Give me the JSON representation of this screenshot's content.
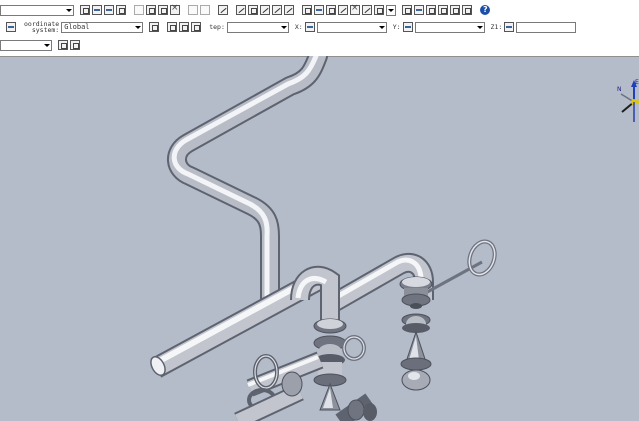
{
  "toolbar": {
    "row1": {
      "dropdown_value": ""
    },
    "row2": {
      "coordinate_system_label_line1": "oordinate",
      "coordinate_system_label_line2": "system:",
      "coordinate_system_value": "Global",
      "step_label": "tep:",
      "step_value": "",
      "x_label": "X:",
      "x_value": "",
      "y_label": "Y:",
      "y_value": "",
      "z_label": "Z1:",
      "z_value": ""
    },
    "row3": {
      "dropdown_value": ""
    }
  },
  "triad": {
    "n_label": "N",
    "e_label": "E"
  },
  "colors": {
    "viewport_bg": "#b4bcca",
    "pipe_light": "#f2f3f6",
    "pipe_mid": "#b9bcc6",
    "pipe_dark": "#6e7380",
    "triad_y_axis": "#e0c700",
    "triad_z_axis": "#1f3fbf",
    "triad_x_axis": "#1e1e1e"
  }
}
